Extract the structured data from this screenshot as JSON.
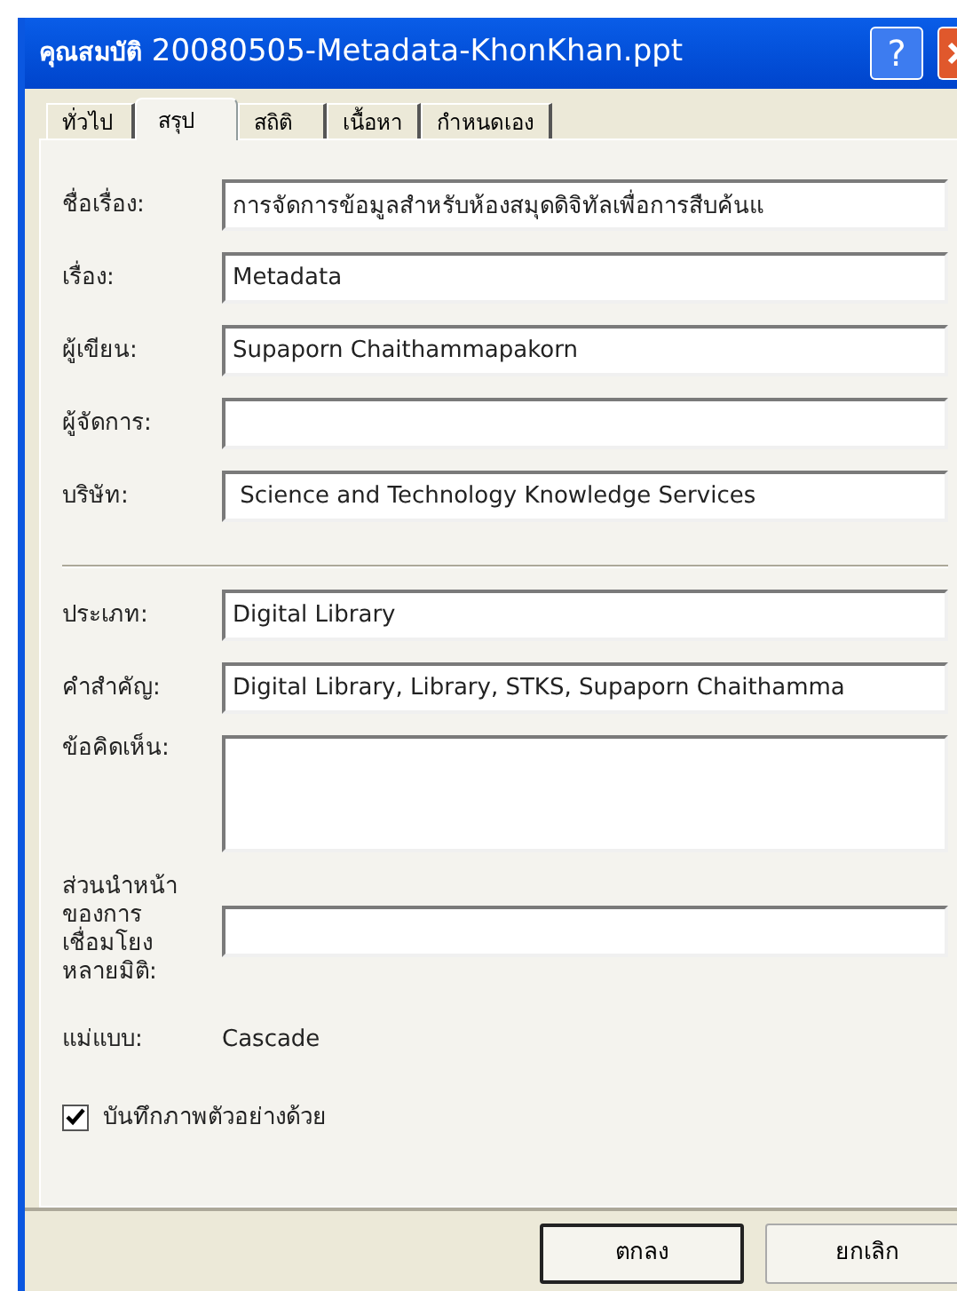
{
  "window": {
    "title_prefix": "คุณสมบัติ",
    "title": "20080505-Metadata-KhonKhan.ppt",
    "help": "?"
  },
  "tabs": [
    {
      "label": "ทั่วไป",
      "selected": false
    },
    {
      "label": "สรุป",
      "selected": true
    },
    {
      "label": "สถิติ",
      "selected": false
    },
    {
      "label": "เนื้อหา",
      "selected": false
    },
    {
      "label": "กำหนดเอง",
      "selected": false
    }
  ],
  "fields": [
    {
      "kind": "text",
      "label": "ชื่อเรื่อง:",
      "value": "การจัดการข้อมูลสำหรับห้องสมุดดิจิทัลเพื่อการสืบค้นแ"
    },
    {
      "kind": "text",
      "label": "เรื่อง:",
      "value": "Metadata"
    },
    {
      "kind": "text",
      "label": "ผู้เขียน:",
      "value": "Supaporn Chaithammapakorn"
    },
    {
      "kind": "text",
      "label": "ผู้จัดการ:"
    },
    {
      "kind": "text",
      "label": "บริษัท:",
      "value": " Science and Technology Knowledge Services"
    },
    {
      "kind": "separator"
    },
    {
      "kind": "text",
      "label": "ประเภท:",
      "value": "Digital Library"
    },
    {
      "kind": "text",
      "label": "คำสำคัญ:",
      "value": "Digital Library, Library, STKS, Supaporn Chaithamma"
    },
    {
      "kind": "multiline",
      "label": "ข้อคิดเห็น:"
    },
    {
      "kind": "text",
      "label": "ส่วนนำหน้า\nของการ\nเชื่อมโยง\nหลายมิติ:"
    },
    {
      "kind": "static",
      "label": "แม่แบบ:",
      "value": "Cascade"
    }
  ],
  "save_preview": {
    "label": "บันทึกภาพตัวอย่างด้วย",
    "checked": true
  },
  "buttons": [
    {
      "label": "ตกลง",
      "default": true
    },
    {
      "label": "ยกเลิก",
      "default": false
    }
  ]
}
